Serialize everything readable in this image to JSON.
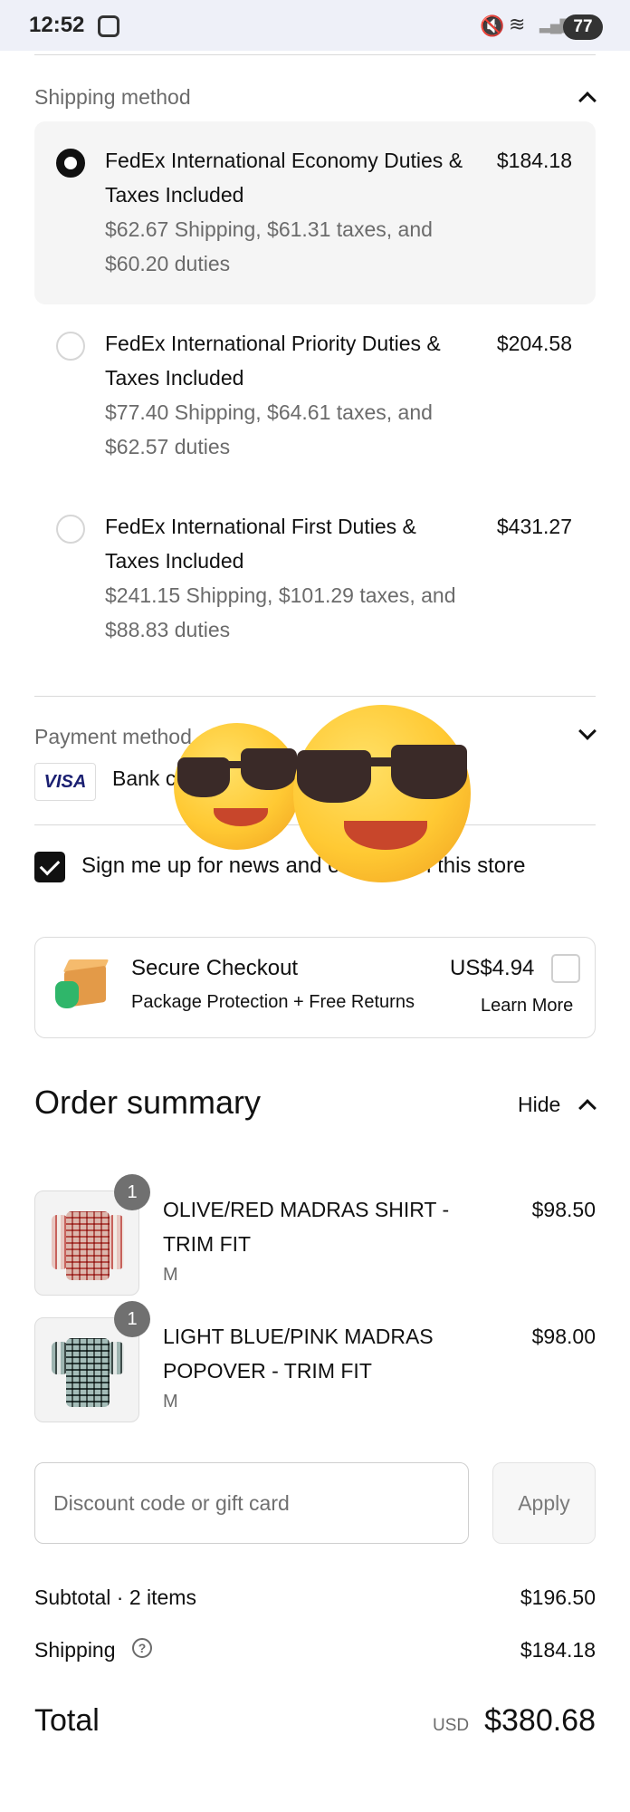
{
  "status_bar": {
    "time": "12:52",
    "battery": "77",
    "icons": [
      "screenshot-icon",
      "mute-icon",
      "wifi-icon",
      "signal-icon",
      "battery-icon"
    ]
  },
  "shipping": {
    "title": "Shipping method",
    "options": [
      {
        "name": "FedEx International Economy Duties & Taxes Included",
        "detail": "$62.67 Shipping, $61.31 taxes, and $60.20 duties",
        "price": "$184.18",
        "selected": true
      },
      {
        "name": "FedEx International Priority Duties & Taxes Included",
        "detail": "$77.40 Shipping, $64.61 taxes, and $62.57 duties",
        "price": "$204.58",
        "selected": false
      },
      {
        "name": "FedEx International First Duties & Taxes Included",
        "detail": "$241.15 Shipping, $101.29 taxes, and $88.83 duties",
        "price": "$431.27",
        "selected": false
      }
    ]
  },
  "payment": {
    "title": "Payment method",
    "card_brand": "VISA",
    "text": "Bank c"
  },
  "newsletter": {
    "label": "Sign me up for news and offers from this store",
    "checked": true
  },
  "secure_checkout": {
    "title": "Secure Checkout",
    "subtitle": "Package Protection + Free Returns",
    "price": "US$4.94",
    "learn_more": "Learn More"
  },
  "order_summary": {
    "title": "Order summary",
    "toggle_label": "Hide",
    "items": [
      {
        "qty": "1",
        "name": "OLIVE/RED MADRAS SHIRT - TRIM FIT",
        "variant": "M",
        "price": "$98.50"
      },
      {
        "qty": "1",
        "name": "LIGHT BLUE/PINK MADRAS POPOVER - TRIM FIT",
        "variant": "M",
        "price": "$98.00"
      }
    ]
  },
  "discount": {
    "placeholder": "Discount code or gift card",
    "apply_label": "Apply"
  },
  "totals": {
    "subtotal_label": "Subtotal · 2 items",
    "subtotal_value": "$196.50",
    "shipping_label": "Shipping",
    "shipping_value": "$184.18",
    "total_label": "Total",
    "currency": "USD",
    "total_value": "$380.68"
  },
  "colors": {
    "accent": "#111111",
    "muted_text": "#6b6b6b",
    "selected_card_bg": "#f5f5f5",
    "status_bar_bg": "#eef0f8"
  }
}
